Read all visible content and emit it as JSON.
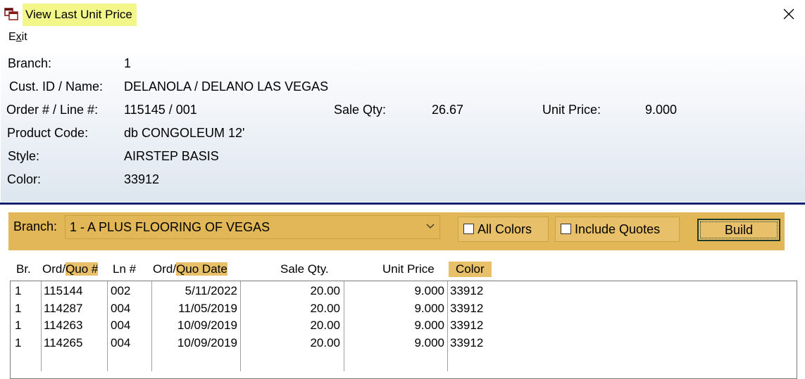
{
  "window": {
    "title": "View Last Unit Price"
  },
  "menu": {
    "exit_label": "Exit"
  },
  "info": {
    "branch_label": "Branch:",
    "branch_value": "1",
    "cust_label": "Cust. ID / Name:",
    "cust_value": "DELANOLA / DELANO LAS VEGAS",
    "order_label": "Order # / Line #:",
    "order_value": "115145 / 001",
    "sale_qty_label": "Sale Qty:",
    "sale_qty_value": "26.67",
    "unit_price_label": "Unit Price:",
    "unit_price_value": "9.000",
    "product_label": "Product Code:",
    "product_value": "db CONGOLEUM 12'",
    "style_label": "Style:",
    "style_value": "AIRSTEP BASIS",
    "color_label": "Color:",
    "color_value": "33912"
  },
  "filter": {
    "branch_label": "Branch:",
    "branch_selected": "1  - A PLUS FLOORING OF VEGAS",
    "all_colors_label": "All Colors",
    "include_quotes_label": "Include Quotes",
    "build_label": "Build",
    "all_colors_checked": false,
    "include_quotes_checked": false
  },
  "columns": {
    "br": "Br.",
    "ord_prefix": "Ord/",
    "ord_hl": "Quo #",
    "ln": "Ln #",
    "date_prefix": "Ord/",
    "date_hl": "Quo Date",
    "qty": "Sale Qty.",
    "price": "Unit Price",
    "color": "Color"
  },
  "rows": [
    {
      "br": "1",
      "ord": "115144",
      "ln": "002",
      "date": "5/11/2022",
      "qty": "20.00",
      "price": "9.000",
      "color": "33912"
    },
    {
      "br": "1",
      "ord": "114287",
      "ln": "004",
      "date": "11/05/2019",
      "qty": "20.00",
      "price": "9.000",
      "color": "33912"
    },
    {
      "br": "1",
      "ord": "114263",
      "ln": "004",
      "date": "10/09/2019",
      "qty": "20.00",
      "price": "9.000",
      "color": "33912"
    },
    {
      "br": "1",
      "ord": "114265",
      "ln": "004",
      "date": "10/09/2019",
      "qty": "20.00",
      "price": "9.000",
      "color": "33912"
    }
  ],
  "colors": {
    "title_highlight": "#f3f78a",
    "filter_bar": "#e1b757",
    "divider": "#0f1f6e"
  },
  "icons": {
    "app": "window-app-icon",
    "close": "close-icon",
    "dropdown": "chevron-down-icon"
  }
}
